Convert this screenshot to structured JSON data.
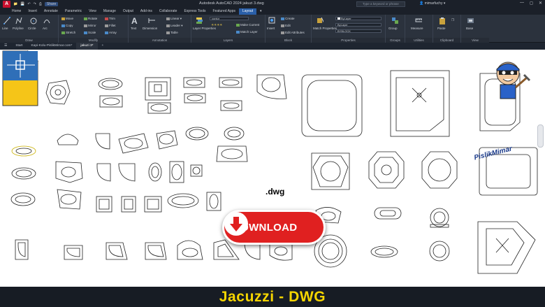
{
  "titlebar": {
    "app_logo": "A",
    "quick_access": [
      "open-icon",
      "save-icon",
      "undo-icon",
      "redo-icon",
      "plot-icon"
    ],
    "share_label": "Share",
    "title": "Autodesk AutoCAD 2024   jakuzi 3.dwg",
    "search_placeholder": "Type a keyword or phrase",
    "user": "mimarfuchy"
  },
  "menu": {
    "tabs": [
      "Home",
      "Insert",
      "Annotate",
      "Parametric",
      "View",
      "Manage",
      "Output",
      "Add-ins",
      "Collaborate",
      "Express Tools",
      "Featured Apps",
      "Layout"
    ],
    "active": "Layout"
  },
  "ribbon": {
    "draw": {
      "label": "Draw",
      "tools": [
        "Line",
        "Polyline",
        "Circle",
        "Arc"
      ]
    },
    "modify": {
      "label": "Modify",
      "tools": [
        "Move",
        "Rotate",
        "Trim",
        "Copy",
        "Mirror",
        "Fillet",
        "Stretch",
        "Scale",
        "Array"
      ]
    },
    "annotation": {
      "label": "Annotation",
      "tools": [
        "Text",
        "Dimension",
        "Linear",
        "Leader",
        "Table"
      ]
    },
    "layers": {
      "label": "Layers",
      "tools": [
        "Layer Properties",
        "Make Current",
        "Match Layer"
      ],
      "layer_value": "contur"
    },
    "block": {
      "label": "Block",
      "tools": [
        "Insert",
        "Create",
        "Edit",
        "Edit Attributes"
      ]
    },
    "properties": {
      "label": "Properties",
      "tools": [
        "Match Properties"
      ],
      "color": "ByLayer",
      "linetype": "ByLayer",
      "lineweight": "BYBLOCK"
    },
    "groups": {
      "label": "Groups",
      "tools": [
        "Group"
      ]
    },
    "utilities": {
      "label": "Utilities",
      "tools": [
        "Measure"
      ]
    },
    "clipboard": {
      "label": "Clipboard",
      "tools": [
        "Paste"
      ]
    },
    "view": {
      "label": "View",
      "tools": [
        "Base"
      ]
    }
  },
  "doctabs": {
    "tabs": [
      "Start",
      "Kapi-Kolu-PislikMimar.com*",
      "jakuzi 3*"
    ],
    "active": "jakuzi 3*"
  },
  "overlay": {
    "file_badge": ".dwg",
    "download_label": "DOWNLOAD",
    "brand": "PislikMimar"
  },
  "banner": {
    "title": "Jacuzzi - DWG"
  },
  "colors": {
    "accent": "#2a5fa8",
    "download": "#e02020",
    "banner_text": "#f6d500"
  }
}
